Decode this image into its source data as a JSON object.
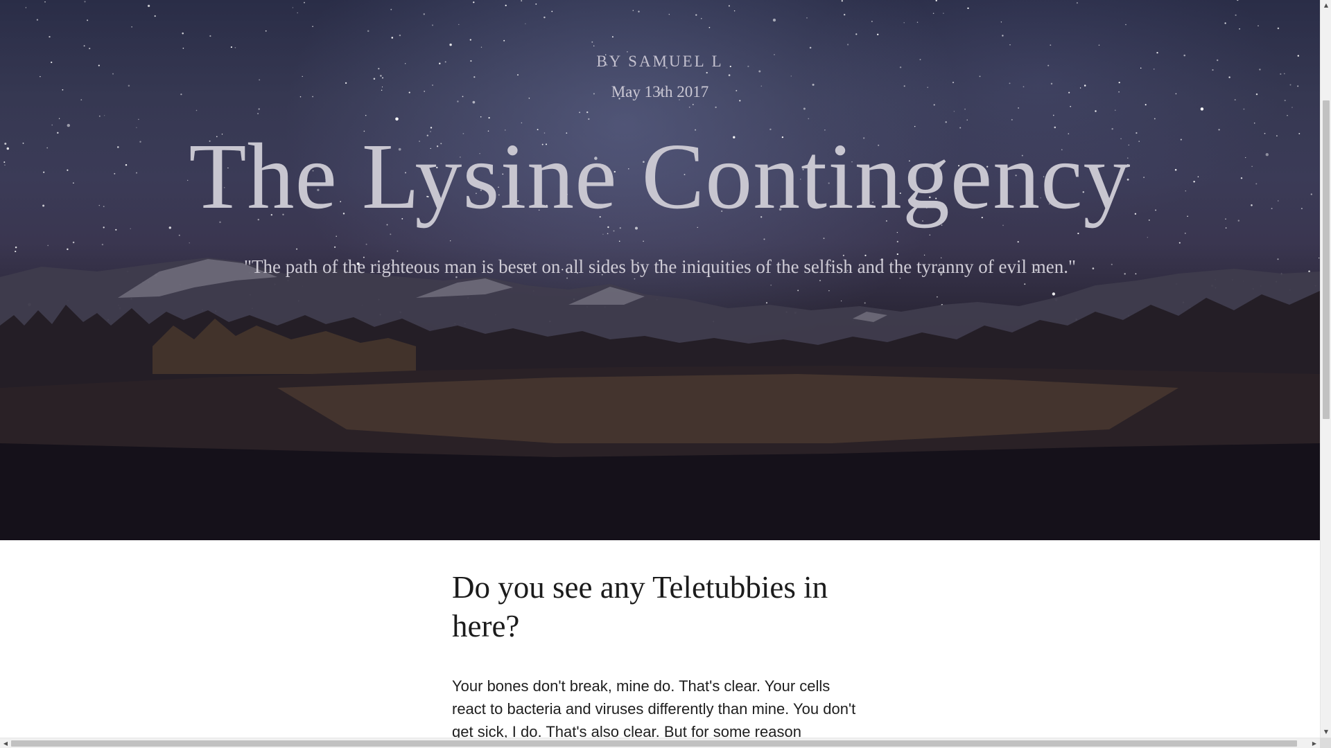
{
  "hero": {
    "byline": "BY SAMUEL L",
    "date": "May 13th 2017",
    "title": "The Lysine Contingency",
    "quote": "\"The path of the righteous man is beset on all sides by the iniquities of the selfish and the tyranny of evil men.\""
  },
  "article": {
    "heading": "Do you see any Teletubbies in here?",
    "paragraph": "Your bones don't break, mine do. That's clear. Your cells react to bacteria and viruses differently than mine. You don't get sick, I do. That's also clear. But for some reason"
  },
  "scrollbars": {
    "vertical": {
      "up_arrow": "▲",
      "down_arrow": "▼"
    },
    "horizontal": {
      "left_arrow": "◀",
      "right_arrow": "▶"
    }
  }
}
